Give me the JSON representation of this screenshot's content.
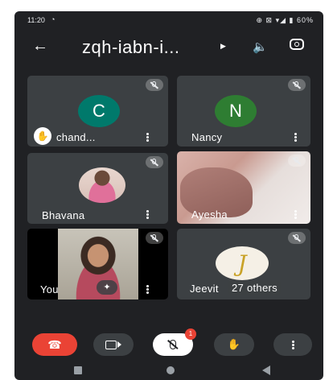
{
  "statusbar": {
    "time": "11:20",
    "right": "⊕ ⊠ ▾◢ ▮ 60%"
  },
  "header": {
    "title": "zqh-iabn-i..."
  },
  "tiles": [
    {
      "name": "chand...",
      "avatar_letter": "C",
      "avatar_color": "#00796b"
    },
    {
      "name": "Nancy",
      "avatar_letter": "N",
      "avatar_color": "#2e7d32"
    },
    {
      "name": "Bhavana"
    },
    {
      "name": "Ayesha"
    },
    {
      "name": "You"
    },
    {
      "name": "Jeevit",
      "others": "27 others"
    }
  ],
  "controls": {
    "end_call_color": "#ea4335",
    "mic_badge": "1"
  },
  "colors": {
    "background": "#202124",
    "tile": "#3c4043"
  }
}
